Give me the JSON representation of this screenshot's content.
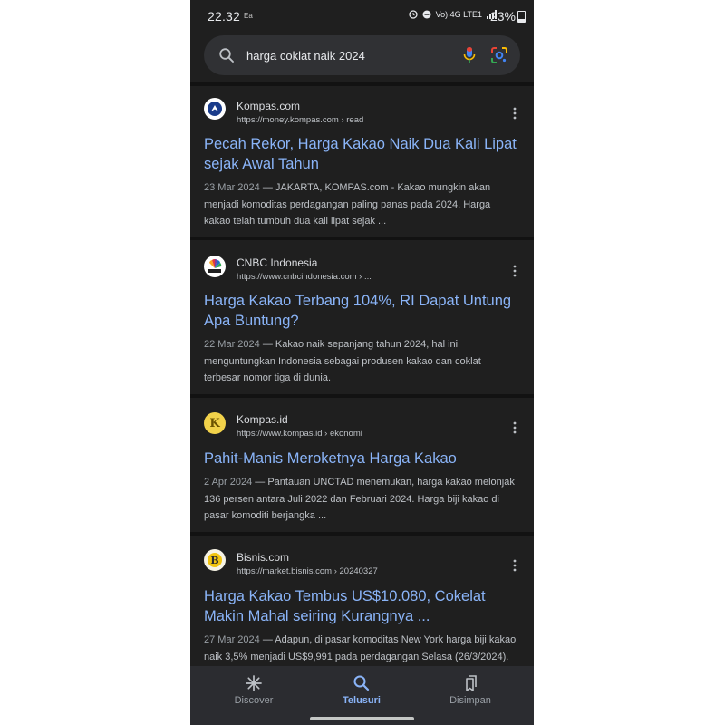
{
  "status_bar": {
    "time": "22.32",
    "small_icon": "Ea",
    "network": "Vo) 4G LTE1",
    "battery": "23%"
  },
  "search": {
    "query": "harga coklat naik 2024",
    "icons": [
      "search-icon",
      "mic-icon",
      "lens-icon"
    ]
  },
  "results": [
    {
      "site": "Kompas.com",
      "url": "https://money.kompas.com › read",
      "title": "Pecah Rekor, Harga Kakao Naik Dua Kali Lipat sejak Awal Tahun",
      "date": "23 Mar 2024",
      "snippet": " — JAKARTA, KOMPAS.com - Kakao mungkin akan menjadi komoditas perdagangan paling panas pada 2024. Harga kakao telah tumbuh dua kali lipat sejak ..."
    },
    {
      "site": "CNBC Indonesia",
      "url": "https://www.cnbcindonesia.com › ...",
      "title": "Harga Kakao Terbang 104%, RI Dapat Untung Apa Buntung?",
      "date": "22 Mar 2024",
      "snippet": " — Kakao naik sepanjang tahun 2024, hal ini menguntungkan Indonesia sebagai produsen kakao dan coklat terbesar nomor tiga di dunia."
    },
    {
      "site": "Kompas.id",
      "url": "https://www.kompas.id › ekonomi",
      "title": "Pahit-Manis Meroketnya Harga Kakao",
      "date": "2 Apr 2024",
      "snippet": " — Pantauan UNCTAD menemukan, harga kakao melonjak 136 persen antara Juli 2022 dan Februari 2024. Harga biji kakao di pasar komoditi berjangka ..."
    },
    {
      "site": "Bisnis.com",
      "url": "https://market.bisnis.com › 20240327",
      "title": "Harga Kakao Tembus US$10.080, Cokelat Makin Mahal seiring Kurangnya ...",
      "date": "27 Mar 2024",
      "snippet": " — Adapun, di pasar komoditas New York harga biji kakao naik 3,5% menjadi US$9,991 pada perdagangan Selasa (26/3/2024). Berdasarkan data ..."
    }
  ],
  "bottom_nav": {
    "items": [
      {
        "label": "Discover",
        "icon": "asterisk-icon"
      },
      {
        "label": "Telusuri",
        "icon": "search-icon",
        "active": true
      },
      {
        "label": "Disimpan",
        "icon": "bookmarks-icon"
      }
    ]
  },
  "colors": {
    "background": "#1f1f1f",
    "title_link": "#8ab4f8",
    "snippet": "#bdc1c6",
    "search_bar": "#303134"
  }
}
